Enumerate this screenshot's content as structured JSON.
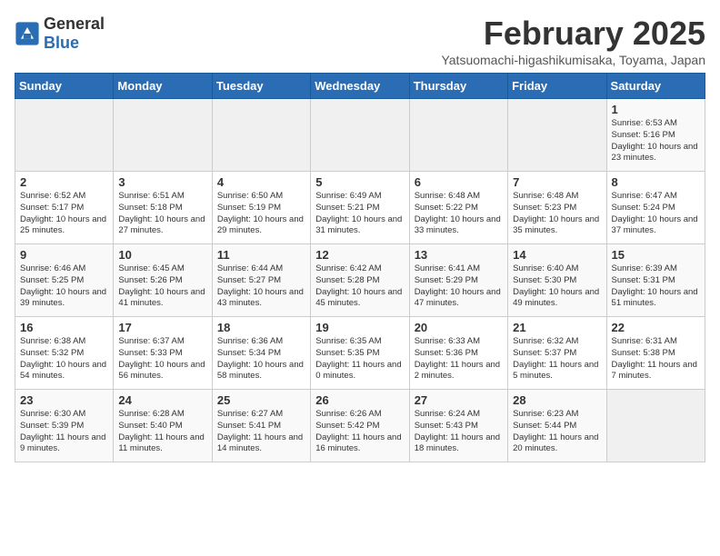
{
  "logo": {
    "general": "General",
    "blue": "Blue"
  },
  "title": "February 2025",
  "subtitle": "Yatsuomachi-higashikumisaka, Toyama, Japan",
  "headers": [
    "Sunday",
    "Monday",
    "Tuesday",
    "Wednesday",
    "Thursday",
    "Friday",
    "Saturday"
  ],
  "weeks": [
    [
      {
        "day": "",
        "info": ""
      },
      {
        "day": "",
        "info": ""
      },
      {
        "day": "",
        "info": ""
      },
      {
        "day": "",
        "info": ""
      },
      {
        "day": "",
        "info": ""
      },
      {
        "day": "",
        "info": ""
      },
      {
        "day": "1",
        "info": "Sunrise: 6:53 AM\nSunset: 5:16 PM\nDaylight: 10 hours and 23 minutes."
      }
    ],
    [
      {
        "day": "2",
        "info": "Sunrise: 6:52 AM\nSunset: 5:17 PM\nDaylight: 10 hours and 25 minutes."
      },
      {
        "day": "3",
        "info": "Sunrise: 6:51 AM\nSunset: 5:18 PM\nDaylight: 10 hours and 27 minutes."
      },
      {
        "day": "4",
        "info": "Sunrise: 6:50 AM\nSunset: 5:19 PM\nDaylight: 10 hours and 29 minutes."
      },
      {
        "day": "5",
        "info": "Sunrise: 6:49 AM\nSunset: 5:21 PM\nDaylight: 10 hours and 31 minutes."
      },
      {
        "day": "6",
        "info": "Sunrise: 6:48 AM\nSunset: 5:22 PM\nDaylight: 10 hours and 33 minutes."
      },
      {
        "day": "7",
        "info": "Sunrise: 6:48 AM\nSunset: 5:23 PM\nDaylight: 10 hours and 35 minutes."
      },
      {
        "day": "8",
        "info": "Sunrise: 6:47 AM\nSunset: 5:24 PM\nDaylight: 10 hours and 37 minutes."
      }
    ],
    [
      {
        "day": "9",
        "info": "Sunrise: 6:46 AM\nSunset: 5:25 PM\nDaylight: 10 hours and 39 minutes."
      },
      {
        "day": "10",
        "info": "Sunrise: 6:45 AM\nSunset: 5:26 PM\nDaylight: 10 hours and 41 minutes."
      },
      {
        "day": "11",
        "info": "Sunrise: 6:44 AM\nSunset: 5:27 PM\nDaylight: 10 hours and 43 minutes."
      },
      {
        "day": "12",
        "info": "Sunrise: 6:42 AM\nSunset: 5:28 PM\nDaylight: 10 hours and 45 minutes."
      },
      {
        "day": "13",
        "info": "Sunrise: 6:41 AM\nSunset: 5:29 PM\nDaylight: 10 hours and 47 minutes."
      },
      {
        "day": "14",
        "info": "Sunrise: 6:40 AM\nSunset: 5:30 PM\nDaylight: 10 hours and 49 minutes."
      },
      {
        "day": "15",
        "info": "Sunrise: 6:39 AM\nSunset: 5:31 PM\nDaylight: 10 hours and 51 minutes."
      }
    ],
    [
      {
        "day": "16",
        "info": "Sunrise: 6:38 AM\nSunset: 5:32 PM\nDaylight: 10 hours and 54 minutes."
      },
      {
        "day": "17",
        "info": "Sunrise: 6:37 AM\nSunset: 5:33 PM\nDaylight: 10 hours and 56 minutes."
      },
      {
        "day": "18",
        "info": "Sunrise: 6:36 AM\nSunset: 5:34 PM\nDaylight: 10 hours and 58 minutes."
      },
      {
        "day": "19",
        "info": "Sunrise: 6:35 AM\nSunset: 5:35 PM\nDaylight: 11 hours and 0 minutes."
      },
      {
        "day": "20",
        "info": "Sunrise: 6:33 AM\nSunset: 5:36 PM\nDaylight: 11 hours and 2 minutes."
      },
      {
        "day": "21",
        "info": "Sunrise: 6:32 AM\nSunset: 5:37 PM\nDaylight: 11 hours and 5 minutes."
      },
      {
        "day": "22",
        "info": "Sunrise: 6:31 AM\nSunset: 5:38 PM\nDaylight: 11 hours and 7 minutes."
      }
    ],
    [
      {
        "day": "23",
        "info": "Sunrise: 6:30 AM\nSunset: 5:39 PM\nDaylight: 11 hours and 9 minutes."
      },
      {
        "day": "24",
        "info": "Sunrise: 6:28 AM\nSunset: 5:40 PM\nDaylight: 11 hours and 11 minutes."
      },
      {
        "day": "25",
        "info": "Sunrise: 6:27 AM\nSunset: 5:41 PM\nDaylight: 11 hours and 14 minutes."
      },
      {
        "day": "26",
        "info": "Sunrise: 6:26 AM\nSunset: 5:42 PM\nDaylight: 11 hours and 16 minutes."
      },
      {
        "day": "27",
        "info": "Sunrise: 6:24 AM\nSunset: 5:43 PM\nDaylight: 11 hours and 18 minutes."
      },
      {
        "day": "28",
        "info": "Sunrise: 6:23 AM\nSunset: 5:44 PM\nDaylight: 11 hours and 20 minutes."
      },
      {
        "day": "",
        "info": ""
      }
    ]
  ]
}
